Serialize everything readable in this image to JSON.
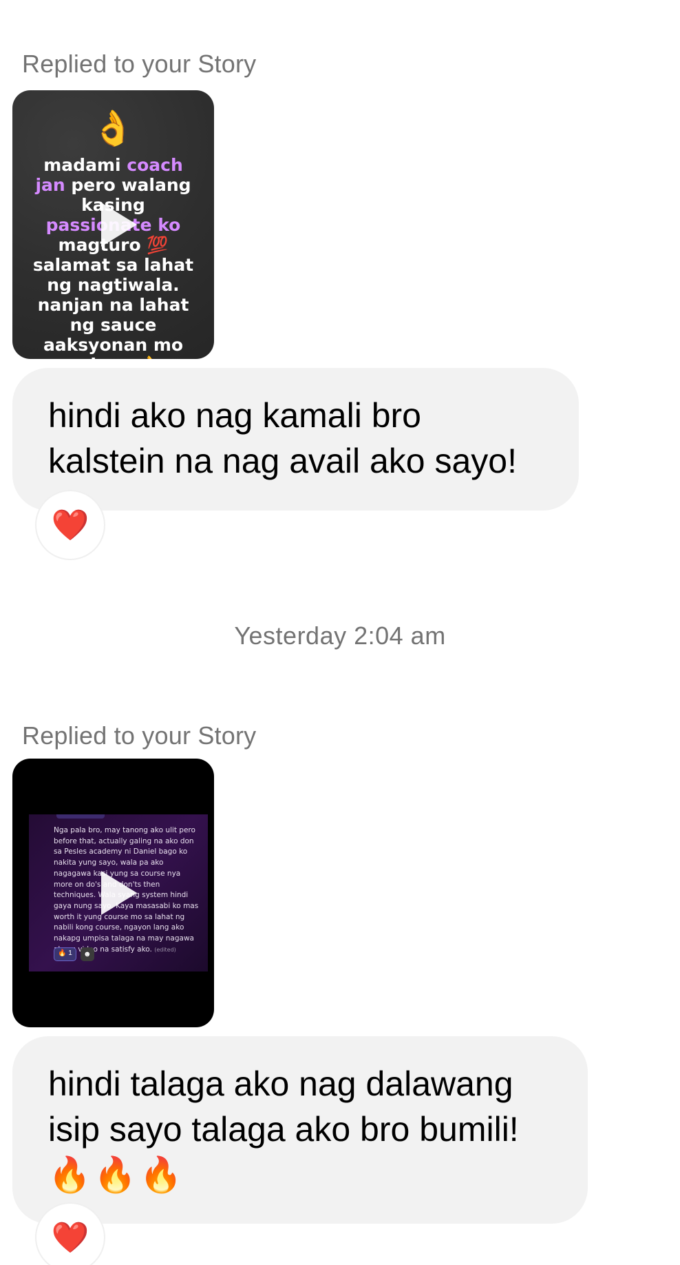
{
  "thread": {
    "reply_label": "Replied to your Story",
    "timestamp": "Yesterday 2:04 am",
    "messages": [
      {
        "story": {
          "emoji": "👌",
          "text_parts": [
            "madami ",
            "coach jan",
            " pero walang kasing ",
            "passionate ko",
            " magturo 💯 salamat sa lahat ng nagtiwala. nanjan na lahat ng sauce aaksyonan mo nalang 👌"
          ]
        },
        "text": "hindi ako nag kamali bro kalstein na nag avail ako sayo!",
        "reaction": "❤️"
      },
      {
        "story": {
          "screenshot_text": "Nga pala bro, may tanong ako ulit pero before that, actually galing na ako don sa Pesles academy ni Daniel bago ko nakita yung sayo, wala pa ako nagagawa kasi yung sa course nya more on do's and don'ts then techniques. Wala syang system hindi gaya nung sayo. Kaya masasabi ko mas worth it yung course mo sa lahat ng nabili kong course, ngayon lang ako nakapg umpisa talaga na may nagawa akong video na satisfy ako.",
          "edited_label": "(edited)",
          "reaction_pill": "🔥 1",
          "add_reaction": "☻"
        },
        "text": "hindi talaga ako nag dalawang isip sayo talaga ako bro bumili!",
        "emoji_line": "🔥🔥🔥",
        "reaction": "❤️"
      }
    ]
  },
  "colors": {
    "bubble_bg": "#f2f2f2",
    "meta_text": "#737373",
    "story_highlight": "#d58aff",
    "heart": "#e0212f"
  },
  "icons": {
    "play": "play-icon",
    "heart": "heart-reaction-icon"
  }
}
